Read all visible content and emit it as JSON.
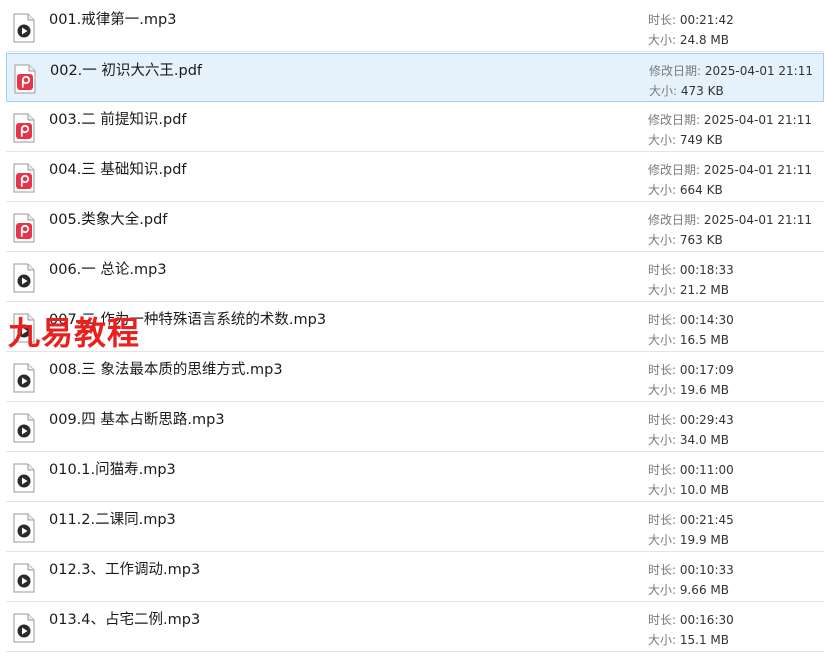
{
  "watermark": "九易教程",
  "files": [
    {
      "name": "001.戒律第一.mp3",
      "type": "audio",
      "k1": "时长: ",
      "v1": "00:21:42",
      "k2": "大小: ",
      "v2": "24.8 MB"
    },
    {
      "name": "002.一 初识大六王.pdf",
      "type": "pdf",
      "k1": "修改日期: ",
      "v1": "2025-04-01 21:11",
      "k2": "大小: ",
      "v2": "473 KB",
      "selected": true
    },
    {
      "name": "003.二 前提知识.pdf",
      "type": "pdf",
      "k1": "修改日期: ",
      "v1": "2025-04-01 21:11",
      "k2": "大小: ",
      "v2": "749 KB"
    },
    {
      "name": "004.三 基础知识.pdf",
      "type": "pdf",
      "k1": "修改日期: ",
      "v1": "2025-04-01 21:11",
      "k2": "大小: ",
      "v2": "664 KB"
    },
    {
      "name": "005.类象大全.pdf",
      "type": "pdf",
      "k1": "修改日期: ",
      "v1": "2025-04-01 21:11",
      "k2": "大小: ",
      "v2": "763 KB"
    },
    {
      "name": "006.一 总论.mp3",
      "type": "audio",
      "k1": "时长: ",
      "v1": "00:18:33",
      "k2": "大小: ",
      "v2": "21.2 MB"
    },
    {
      "name": "007.二 作为一种特殊语言系统的术数.mp3",
      "type": "audio",
      "k1": "时长: ",
      "v1": "00:14:30",
      "k2": "大小: ",
      "v2": "16.5 MB"
    },
    {
      "name": "008.三 象法最本质的思维方式.mp3",
      "type": "audio",
      "k1": "时长: ",
      "v1": "00:17:09",
      "k2": "大小: ",
      "v2": "19.6 MB"
    },
    {
      "name": "009.四 基本占断思路.mp3",
      "type": "audio",
      "k1": "时长: ",
      "v1": "00:29:43",
      "k2": "大小: ",
      "v2": "34.0 MB"
    },
    {
      "name": "010.1.问猫寿.mp3",
      "type": "audio",
      "k1": "时长: ",
      "v1": "00:11:00",
      "k2": "大小: ",
      "v2": "10.0 MB"
    },
    {
      "name": "011.2.二课同.mp3",
      "type": "audio",
      "k1": "时长: ",
      "v1": "00:21:45",
      "k2": "大小: ",
      "v2": "19.9 MB"
    },
    {
      "name": "012.3、工作调动.mp3",
      "type": "audio",
      "k1": "时长: ",
      "v1": "00:10:33",
      "k2": "大小: ",
      "v2": "9.66 MB"
    },
    {
      "name": "013.4、占宅二例.mp3",
      "type": "audio",
      "k1": "时长: ",
      "v1": "00:16:30",
      "k2": "大小: ",
      "v2": "15.1 MB"
    }
  ]
}
